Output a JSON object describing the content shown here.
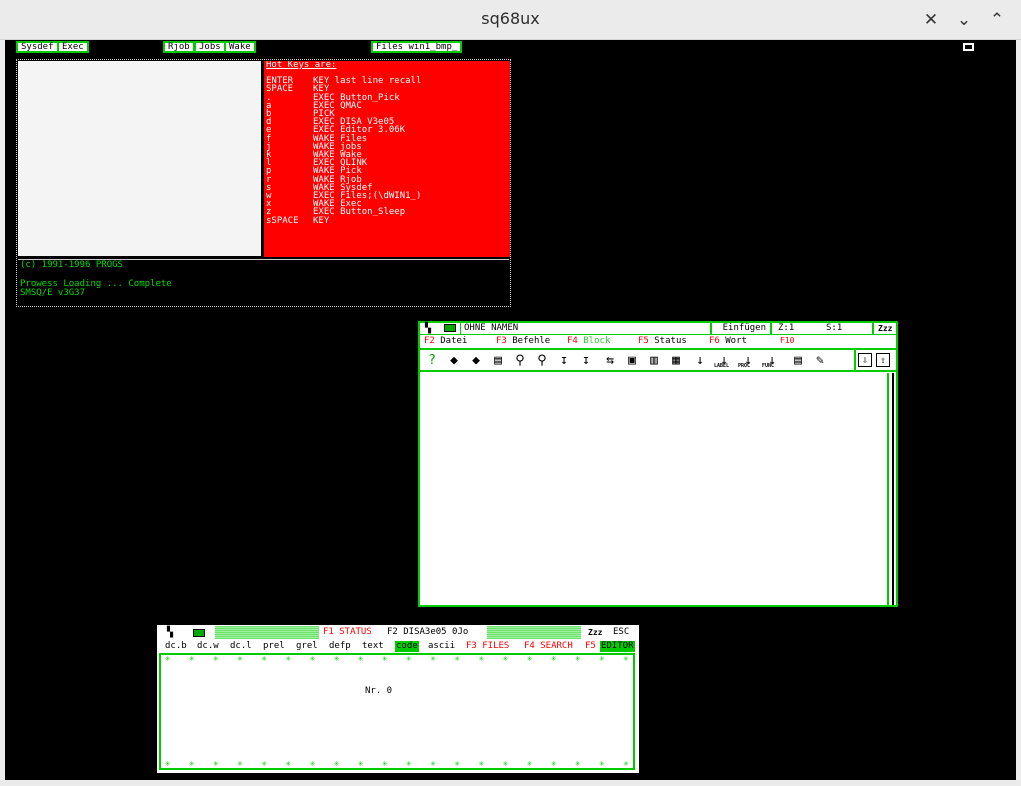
{
  "window": {
    "title": "sq68ux",
    "controls": [
      "✕",
      "⌄",
      "⌃"
    ]
  },
  "topbar": {
    "buttons": [
      {
        "label": "Sysdef"
      },
      {
        "label": "Exec"
      },
      {
        "label": "Rjob"
      },
      {
        "label": "Jobs"
      },
      {
        "label": "Wake"
      },
      {
        "label": "Files win1_bmp_"
      }
    ]
  },
  "hotkeys": {
    "title": "Hot Keys are:",
    "rows": [
      {
        "key": "ENTER",
        "action": "KEY last line recall"
      },
      {
        "key": "SPACE",
        "action": "KEY"
      },
      {
        "key": ".",
        "action": "EXEC Button_Pick"
      },
      {
        "key": "a",
        "action": "EXEC QMAC"
      },
      {
        "key": "b",
        "action": "PICK"
      },
      {
        "key": "d",
        "action": "EXEC DISA V3e05"
      },
      {
        "key": "e",
        "action": "EXEC Editor 3.06K"
      },
      {
        "key": "f",
        "action": "WAKE Files"
      },
      {
        "key": "j",
        "action": "WAKE jobs"
      },
      {
        "key": "k",
        "action": "WAKE Wake"
      },
      {
        "key": "l",
        "action": "EXEC QLINK"
      },
      {
        "key": "p",
        "action": "WAKE Pick"
      },
      {
        "key": "r",
        "action": "WAKE Rjob"
      },
      {
        "key": "s",
        "action": "WAKE Sysdef"
      },
      {
        "key": "w",
        "action": "EXEC Files;(\\dWIN1_)"
      },
      {
        "key": "x",
        "action": "WAKE Exec"
      },
      {
        "key": "z",
        "action": "EXEC Button_Sleep"
      },
      {
        "key": "sSPACE",
        "action": "KEY"
      }
    ]
  },
  "console": {
    "copyright": "(c) 1991-1996 PROGS",
    "line1": "Prowess Loading ... Complete",
    "line2": "SMSQ/E v3G37"
  },
  "editor": {
    "name": "OHNE NAMEN",
    "mode": "Einfügen",
    "line": "Z:1",
    "col": "S:1",
    "zz": "Zzz",
    "menu": [
      {
        "f": "F2",
        "label": "Datei"
      },
      {
        "f": "F3",
        "label": "Befehle"
      },
      {
        "f": "F4",
        "label": "Block"
      },
      {
        "f": "F5",
        "label": "Status"
      },
      {
        "f": "F6",
        "label": "Wort"
      },
      {
        "f": "F10",
        "label": ""
      }
    ],
    "colors": {
      "fkey": "#ff0000",
      "accent": "#00cc00",
      "block": "#33cc33"
    },
    "tools": [
      "help-icon",
      "diamond-icon",
      "diamond2-icon",
      "printer-icon",
      "find-icon",
      "replace-icon",
      "sort-icon",
      "sort2-icon",
      "link-icon",
      "camera-icon",
      "trash-icon",
      "save-icon",
      "block-icon",
      "label-icon",
      "proc-icon",
      "func-icon",
      "grid-icon",
      "pen-icon",
      "down-icon",
      "up-icon"
    ],
    "tool_glyphs": [
      "?",
      "◆",
      "◆",
      "▤",
      "⚲",
      "⚲",
      "↧",
      "↧",
      "⇆",
      "▣",
      "▥",
      "▦",
      "↓",
      "↓",
      "↓",
      "↓",
      "▤",
      "✎",
      "⇩",
      "⇧"
    ],
    "tool_captions": {
      "label": "LABEL",
      "proc": "PROC",
      "func": "FUNC"
    }
  },
  "disa": {
    "status": "F1 STATUS",
    "title": "F2 DISA3e05 0Jo",
    "zz": "Zzz",
    "esc": "ESC",
    "menu": [
      "dc.b",
      "dc.w",
      "dc.l",
      "prel",
      "grel",
      "defp",
      "text",
      "code",
      "ascii",
      "F3 FILES",
      "F4 SEARCH",
      "F5",
      "EDITOR"
    ],
    "body_text": "Nr. 0"
  }
}
